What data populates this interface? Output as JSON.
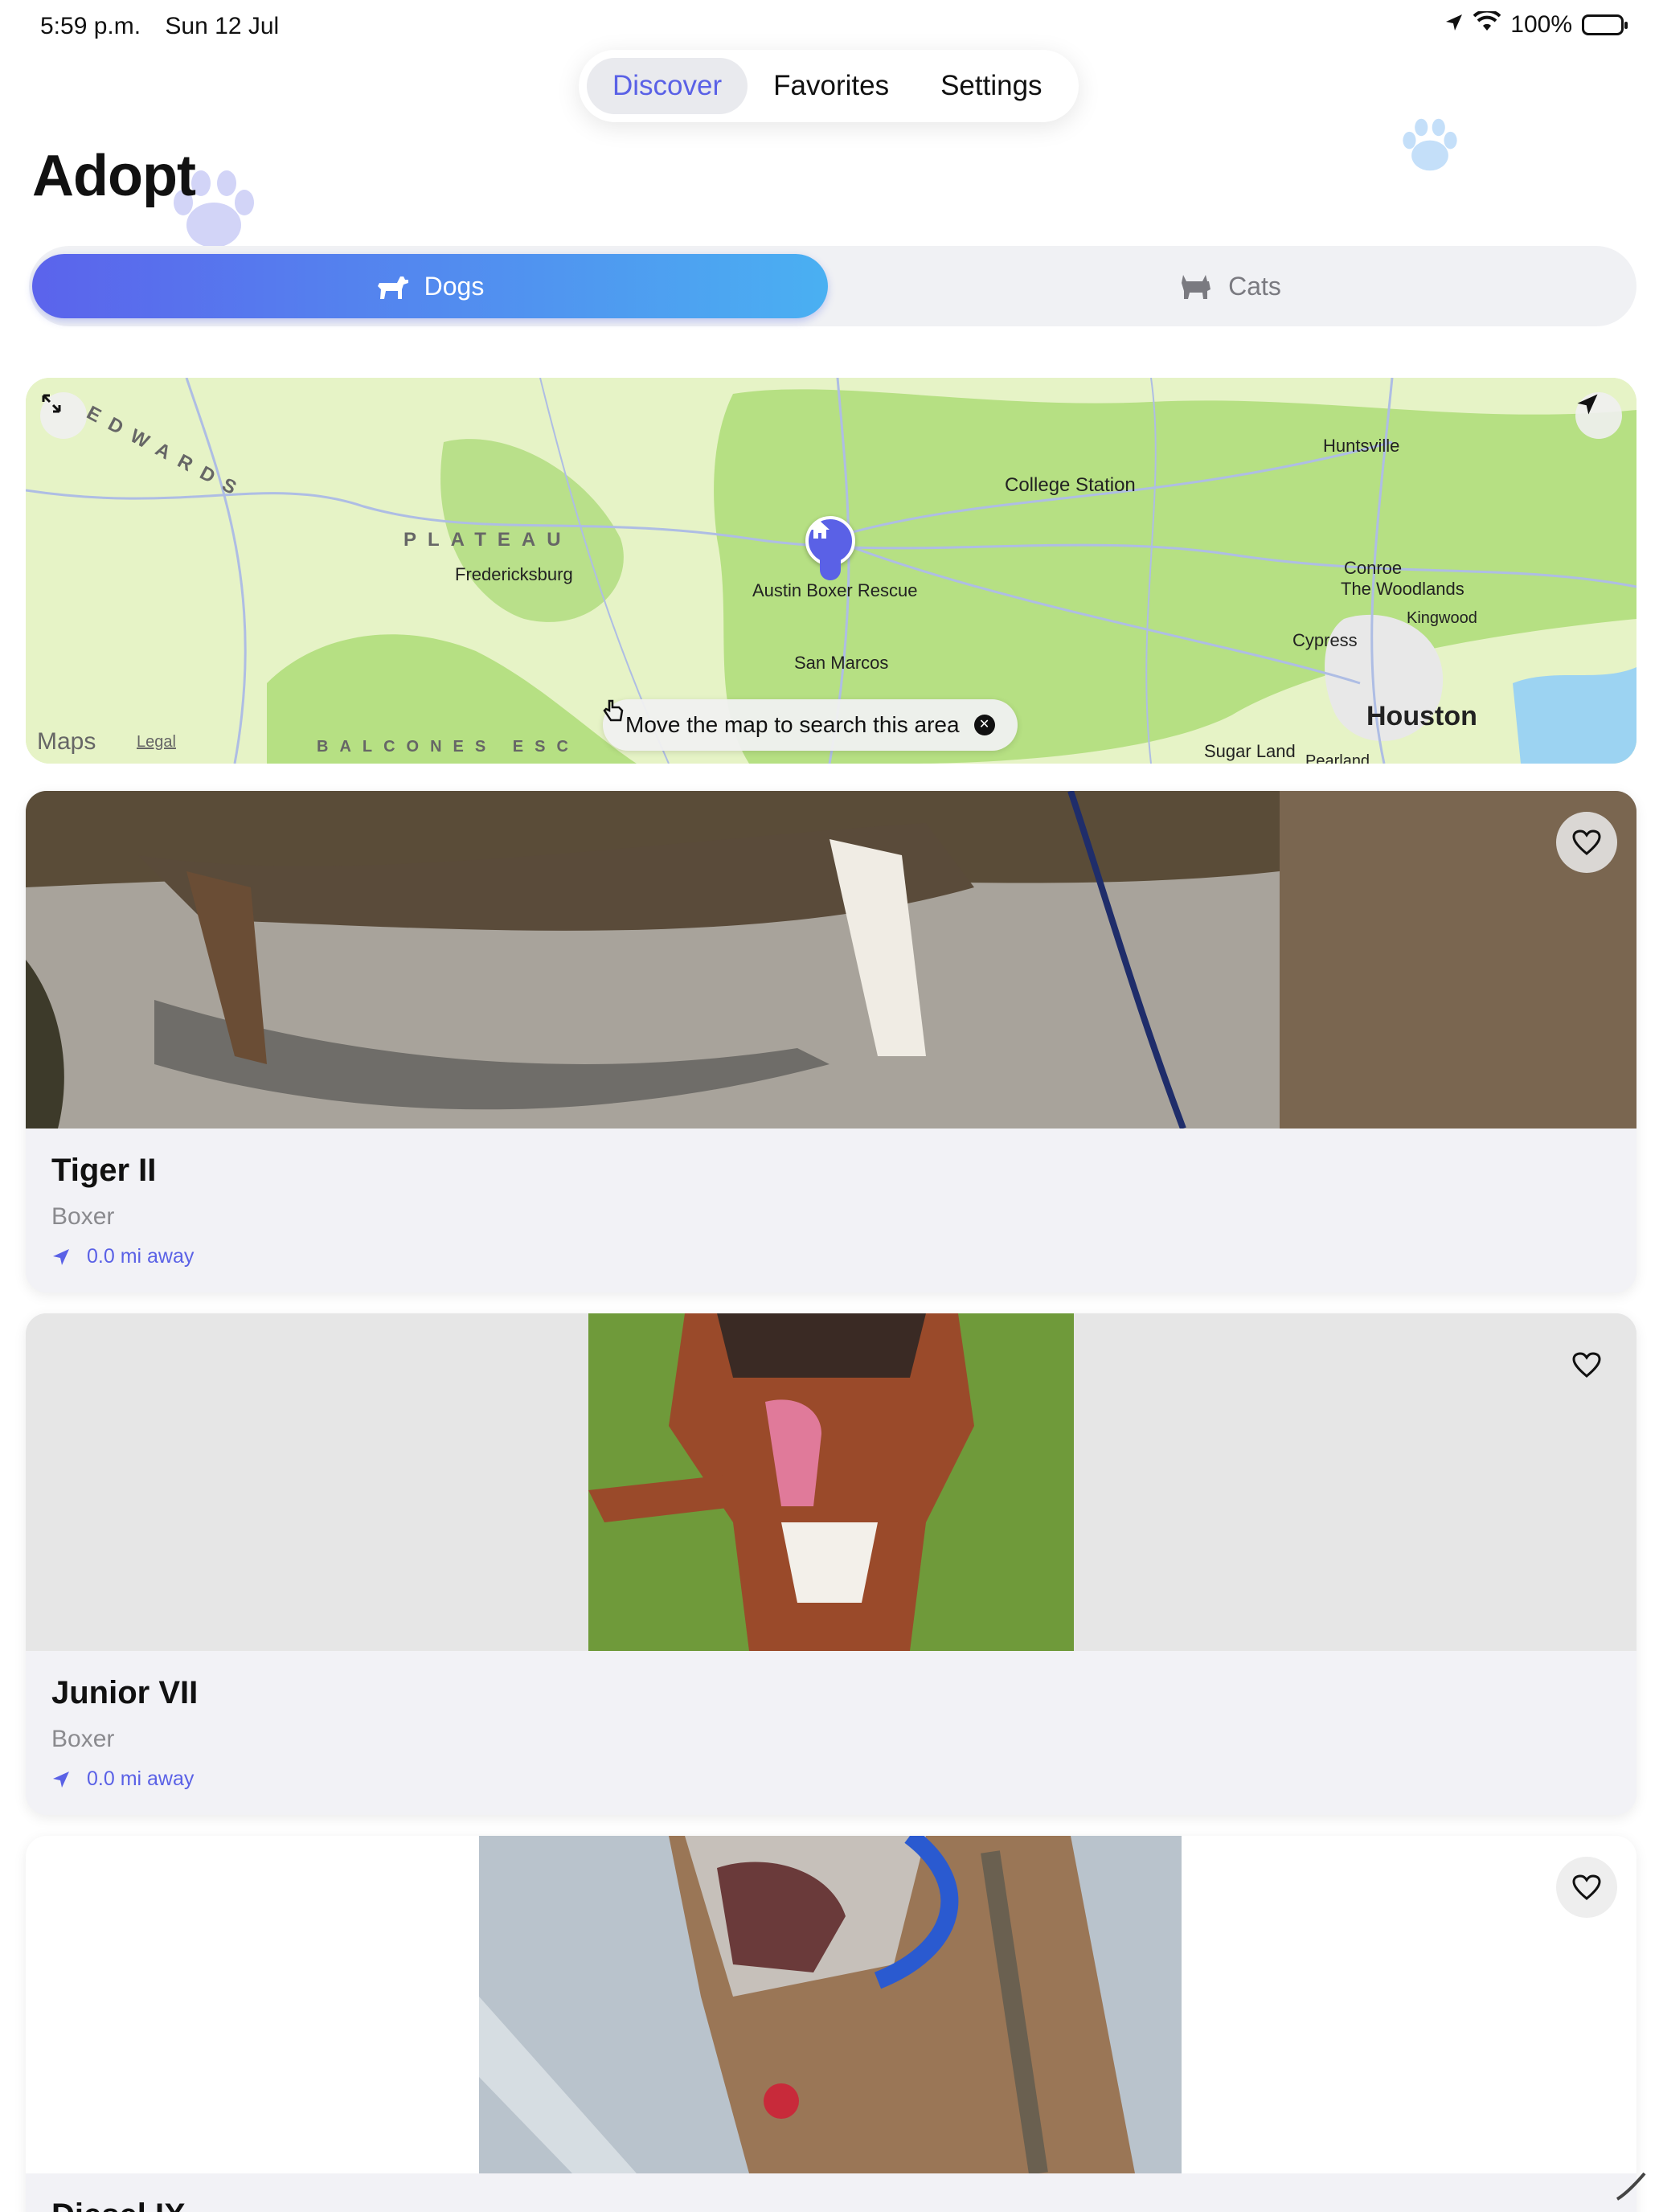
{
  "status_bar": {
    "time": "5:59 p.m.",
    "date": "Sun 12 Jul",
    "battery": "100%"
  },
  "nav": {
    "tabs": [
      "Discover",
      "Favorites",
      "Settings"
    ],
    "active": "Discover"
  },
  "page": {
    "title": "Adopt"
  },
  "segment": {
    "dogs_label": "Dogs",
    "cats_label": "Cats",
    "selected": "Dogs"
  },
  "map": {
    "places": {
      "huntsville": "Huntsville",
      "college_station": "College Station",
      "fredericksburg": "Fredericksburg",
      "austin_boxer_rescue": "Austin Boxer Rescue",
      "conroe": "Conroe",
      "the_woodlands": "The Woodlands",
      "kingwood": "Kingwood",
      "cypress": "Cypress",
      "san_marcos": "San Marcos",
      "houston": "Houston",
      "sugar_land": "Sugar Land",
      "pearland": "Pearland"
    },
    "regions": {
      "edwards": "EDWARDS",
      "plateau": "PLATEAU",
      "balcones": "BALCONES ESC"
    },
    "search_hint": "Move the map to search this area",
    "brand": "Maps",
    "legal": "Legal"
  },
  "pets": [
    {
      "name": "Tiger II",
      "breed": "Boxer",
      "distance": "0.0 mi away"
    },
    {
      "name": "Junior VII",
      "breed": "Boxer",
      "distance": "0.0 mi away"
    },
    {
      "name": "Diesel IX",
      "breed": "",
      "distance": ""
    }
  ],
  "colors": {
    "accent": "#5a61e6",
    "gradient_start": "#5b63ec",
    "gradient_end": "#4ab0f2"
  }
}
